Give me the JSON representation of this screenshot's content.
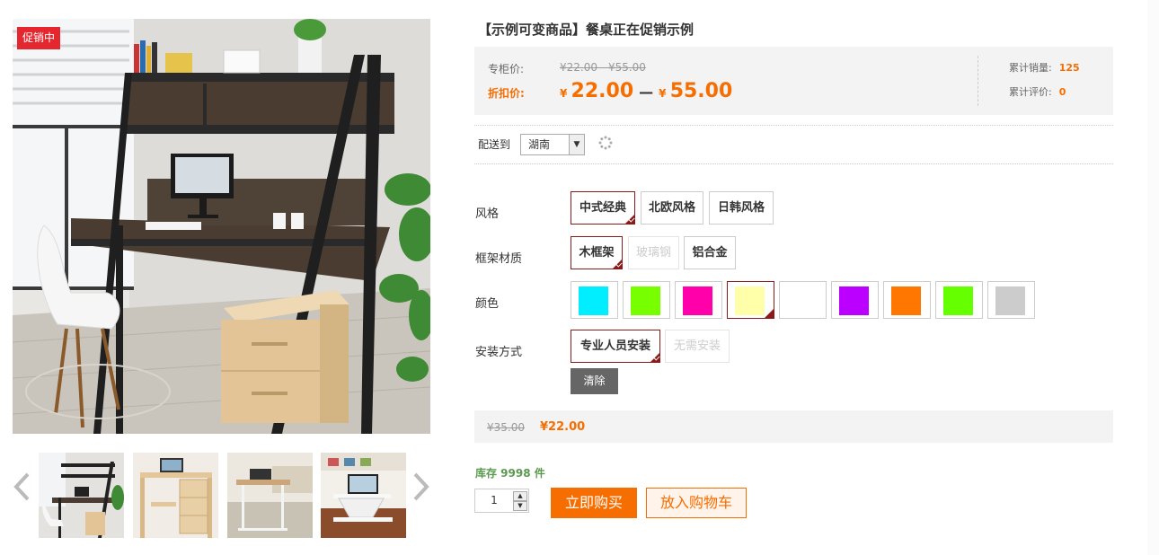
{
  "gallery": {
    "promo_badge": "促销中",
    "main_image": "desk-bookshelf-photo",
    "thumbnails": [
      "desk-bookshelf-thumb",
      "wooden-desk-thumb",
      "laptop-table-thumb",
      "standing-desk-thumb"
    ],
    "prev_icon": "chevron-left-icon",
    "next_icon": "chevron-right-icon"
  },
  "product": {
    "title": "【示例可变商品】餐桌正在促销示例"
  },
  "price": {
    "counter_label": "专柜价:",
    "counter_value": "¥22.00 - ¥55.00",
    "discount_label": "折扣价:",
    "currency": "¥",
    "discount_min": "22.00",
    "range_dash": "—",
    "discount_max": "55.00",
    "sales_label": "累计销量:",
    "sales_value": "125",
    "reviews_label": "累计评价:",
    "reviews_value": "0"
  },
  "shipping": {
    "label": "配送到",
    "selected_region": "湖南",
    "arrow": "▼",
    "loading_icon": "spinner-icon"
  },
  "specs": {
    "style": {
      "label": "风格",
      "options": [
        {
          "label": "中式经典",
          "state": "selected"
        },
        {
          "label": "北欧风格",
          "state": "normal"
        },
        {
          "label": "日韩风格",
          "state": "normal"
        }
      ]
    },
    "frame": {
      "label": "框架材质",
      "options": [
        {
          "label": "木框架",
          "state": "selected"
        },
        {
          "label": "玻璃钢",
          "state": "disabled"
        },
        {
          "label": "铝合金",
          "state": "normal"
        }
      ]
    },
    "color": {
      "label": "颜色",
      "swatches": [
        {
          "color": "#00eeff",
          "state": "normal"
        },
        {
          "color": "#77ff00",
          "state": "normal"
        },
        {
          "color": "#ff00aa",
          "state": "normal"
        },
        {
          "color": "#ffffaa",
          "state": "selected"
        },
        {
          "color": "#ffffff",
          "state": "normal"
        },
        {
          "color": "#bb00ff",
          "state": "normal"
        },
        {
          "color": "#ff7700",
          "state": "normal"
        },
        {
          "color": "#66ff00",
          "state": "normal"
        },
        {
          "color": "#cccccc",
          "state": "normal"
        }
      ]
    },
    "install": {
      "label": "安装方式",
      "options": [
        {
          "label": "专业人员安装",
          "state": "selected"
        },
        {
          "label": "无需安装",
          "state": "disabled"
        }
      ]
    },
    "clear_label": "清除"
  },
  "selection_price": {
    "old": "¥35.00",
    "new": "¥22.00"
  },
  "purchase": {
    "stock": "库存 9998 件",
    "quantity": "1",
    "buy_label": "立即购买",
    "cart_label": "放入购物车"
  },
  "colors": {
    "accent": "#f66d00",
    "selected_border": "#8b1a1a",
    "promo_red": "#e4262e",
    "stock_green": "#5a9a4e"
  }
}
